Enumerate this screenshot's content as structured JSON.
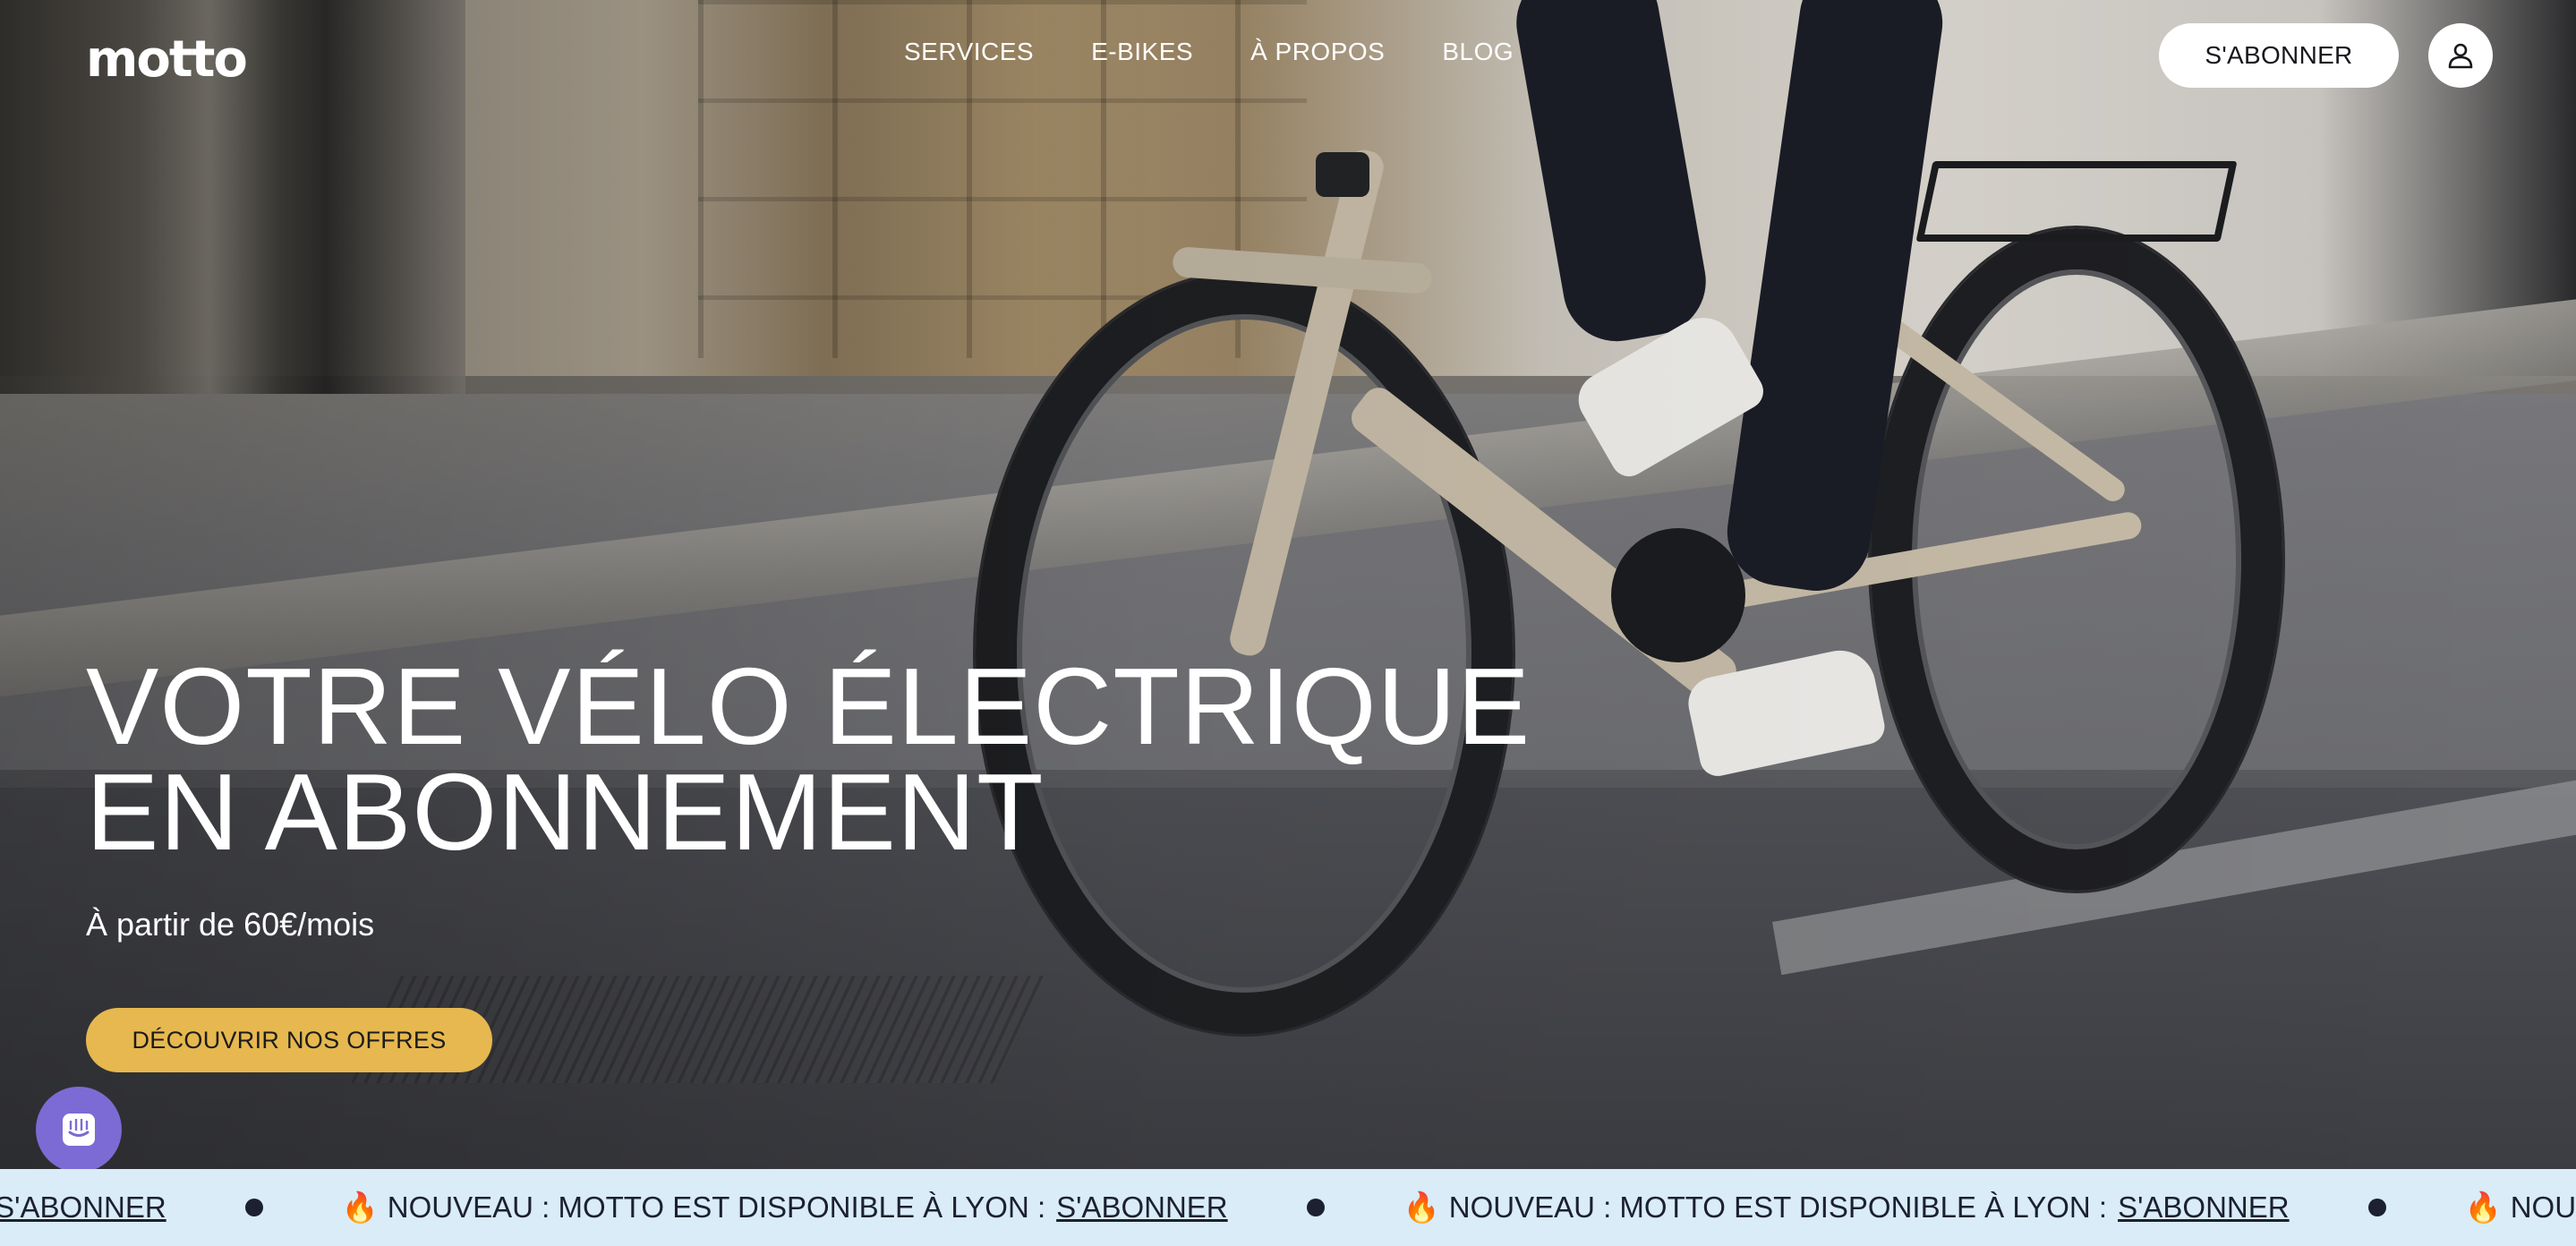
{
  "header": {
    "logo": "motto",
    "nav": [
      "SERVICES",
      "E-BIKES",
      "À PROPOS",
      "BLOG"
    ],
    "subscribe_label": "S'ABONNER",
    "account_icon": "user-icon"
  },
  "hero": {
    "title_line1": "VOTRE VÉLO ÉLECTRIQUE",
    "title_line2": "EN ABONNEMENT",
    "subtitle": "À partir de 60€/mois",
    "cta_label": "DÉCOUVRIR NOS OFFRES",
    "image_subject": "person riding beige e-bike on city street"
  },
  "chat": {
    "icon": "chat-icon"
  },
  "banner": {
    "prefix": "🔥",
    "text": "NOUVEAU : MOTTO EST DISPONIBLE À LYON :",
    "link": "S'ABONNER",
    "fragment_start": "N :",
    "fragment_end": "NOUVE"
  },
  "colors": {
    "cta": "#e6b84f",
    "banner_bg": "#d9ecf8",
    "chat": "#7c6bd4",
    "text_light": "#ffffff"
  }
}
